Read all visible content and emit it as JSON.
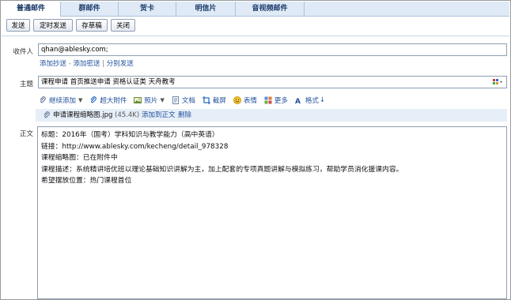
{
  "tabs": [
    {
      "label": "普通邮件",
      "active": true
    },
    {
      "label": "群邮件",
      "active": false
    },
    {
      "label": "贺卡",
      "active": false
    },
    {
      "label": "明信片",
      "active": false
    },
    {
      "label": "音视频邮件",
      "active": false
    }
  ],
  "toolbar": {
    "send": "发送",
    "scheduled_send": "定时发送",
    "save_draft": "存草稿",
    "close": "关闭"
  },
  "recipient": {
    "label": "收件人",
    "value": "qhan@ablesky.com;",
    "add_cc": "添加抄送",
    "add_bcc": "添加密送",
    "separate_send": "分别发送",
    "sep": "-",
    "sep2": "|"
  },
  "subject": {
    "label": "主题",
    "value": "课程申请 首页推送申请 资格认证类 天舟教考"
  },
  "attach_toolbar": {
    "continue_add": "继续添加",
    "large_attachment": "超大附件",
    "photo": "照片",
    "document": "文档",
    "screenshot": "截屏",
    "emoji": "表情",
    "more": "更多",
    "format": "格式"
  },
  "attachment": {
    "filename": "申请课程缩略图.jpg",
    "size": "(45.4K)",
    "add_to_body": "添加到正文",
    "delete": "删除"
  },
  "body": {
    "label": "正文",
    "lines": [
      "标题：2016年（国考）学科知识与教学能力（高中英语）",
      "链接：http://www.ablesky.com/kecheng/detail_978328",
      "课程缩略图：已在附件中",
      "课程描述：系统精讲培优班以理论基础知识讲解为主，加上配套的专项真题讲解与模拟练习，帮助学员消化援课内容。",
      "希望摆放位置：热门课程首位"
    ]
  },
  "colors": {
    "tab_bg": "#dfeaf6",
    "link": "#1f4f9c",
    "attachment_bar": "#e6eef7",
    "border": "#8e9fb4"
  }
}
